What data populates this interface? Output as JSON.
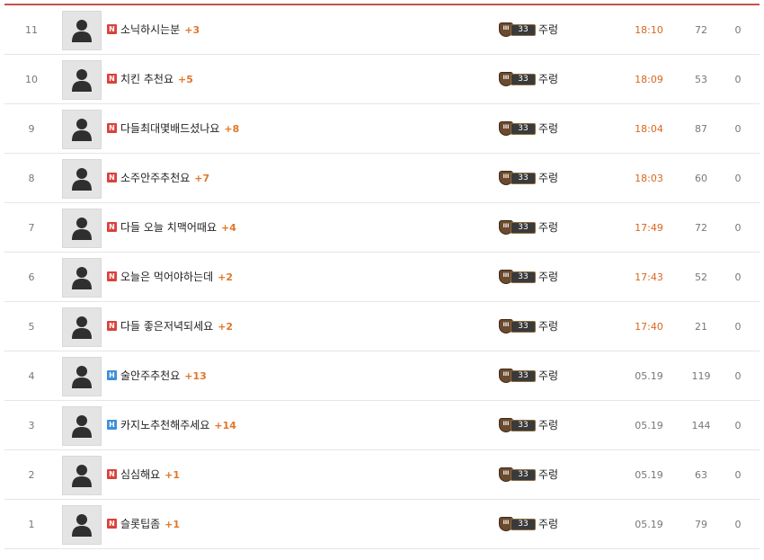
{
  "posts": [
    {
      "num": "11",
      "badge": "N",
      "badge_color": "red",
      "title": "소닉하시는분",
      "comments": "+3",
      "level": "33",
      "author": "주렁",
      "date": "18:10",
      "date_today": true,
      "views": "72",
      "likes": "0"
    },
    {
      "num": "10",
      "badge": "N",
      "badge_color": "red",
      "title": "치킨 추천요",
      "comments": "+5",
      "level": "33",
      "author": "주렁",
      "date": "18:09",
      "date_today": true,
      "views": "53",
      "likes": "0"
    },
    {
      "num": "9",
      "badge": "N",
      "badge_color": "red",
      "title": "다들최대몇배드셨나요",
      "comments": "+8",
      "level": "33",
      "author": "주렁",
      "date": "18:04",
      "date_today": true,
      "views": "87",
      "likes": "0"
    },
    {
      "num": "8",
      "badge": "N",
      "badge_color": "red",
      "title": "소주안주추천요",
      "comments": "+7",
      "level": "33",
      "author": "주렁",
      "date": "18:03",
      "date_today": true,
      "views": "60",
      "likes": "0"
    },
    {
      "num": "7",
      "badge": "N",
      "badge_color": "red",
      "title": "다들 오늘 치맥어때요",
      "comments": "+4",
      "level": "33",
      "author": "주렁",
      "date": "17:49",
      "date_today": true,
      "views": "72",
      "likes": "0"
    },
    {
      "num": "6",
      "badge": "N",
      "badge_color": "red",
      "title": "오늘은 먹어야하는데",
      "comments": "+2",
      "level": "33",
      "author": "주렁",
      "date": "17:43",
      "date_today": true,
      "views": "52",
      "likes": "0"
    },
    {
      "num": "5",
      "badge": "N",
      "badge_color": "red",
      "title": "다들 좋은저녁되세요",
      "comments": "+2",
      "level": "33",
      "author": "주렁",
      "date": "17:40",
      "date_today": true,
      "views": "21",
      "likes": "0"
    },
    {
      "num": "4",
      "badge": "H",
      "badge_color": "blue",
      "title": "술안주추천요",
      "comments": "+13",
      "level": "33",
      "author": "주렁",
      "date": "05.19",
      "date_today": false,
      "views": "119",
      "likes": "0"
    },
    {
      "num": "3",
      "badge": "H",
      "badge_color": "blue",
      "title": "카지노추천해주세요",
      "comments": "+14",
      "level": "33",
      "author": "주렁",
      "date": "05.19",
      "date_today": false,
      "views": "144",
      "likes": "0"
    },
    {
      "num": "2",
      "badge": "N",
      "badge_color": "red",
      "title": "심심해요",
      "comments": "+1",
      "level": "33",
      "author": "주렁",
      "date": "05.19",
      "date_today": false,
      "views": "63",
      "likes": "0"
    },
    {
      "num": "1",
      "badge": "N",
      "badge_color": "red",
      "title": "슬롯팁좀",
      "comments": "+1",
      "level": "33",
      "author": "주렁",
      "date": "05.19",
      "date_today": false,
      "views": "79",
      "likes": "0"
    }
  ],
  "level_icon_text": "III",
  "colors": {
    "accent_line": "#c9524a",
    "badge_new": "#d9423b",
    "badge_hot": "#3d8fd6",
    "comment": "#e2762a",
    "date_today": "#d9661f"
  },
  "icons": {
    "thumbnail": "user-silhouette-icon",
    "level": "level-shield-icon"
  }
}
